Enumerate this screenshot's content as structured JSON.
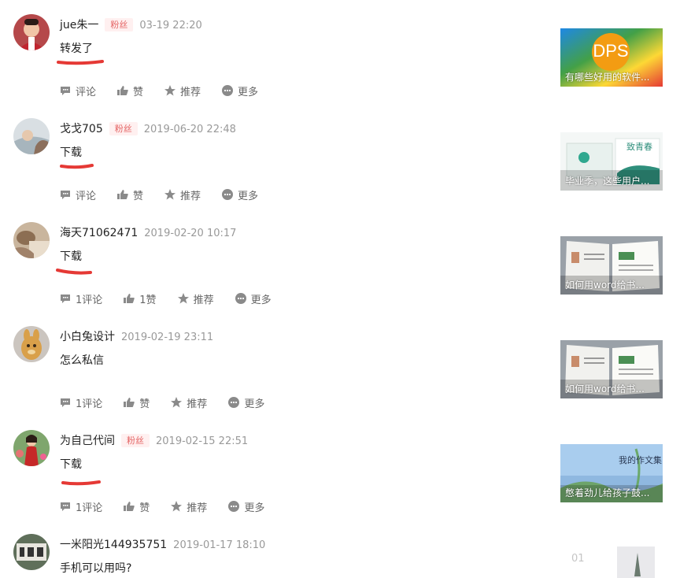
{
  "comments": [
    {
      "name": "jue朱一",
      "fan_badge": "粉丝",
      "time": "03-19 22:20",
      "text": "转发了",
      "actions": {
        "comment": "评论",
        "like": "赞",
        "recommend": "推荐",
        "more": "更多"
      },
      "thumb_caption": "有哪些好用的软件...",
      "thumb_logo": "DPS"
    },
    {
      "name": "戈戈705",
      "fan_badge": "粉丝",
      "time": "2019-06-20 22:48",
      "text": "下载",
      "actions": {
        "comment": "评论",
        "like": "赞",
        "recommend": "推荐",
        "more": "更多"
      },
      "thumb_caption": "毕业季，这些用户...",
      "thumb_title": "致青春"
    },
    {
      "name": "海天71062471",
      "time": "2019-02-20 10:17",
      "text": "下载",
      "actions": {
        "comment": "1评论",
        "like": "1赞",
        "recommend": "推荐",
        "more": "更多"
      },
      "thumb_caption": "如何用word给书..."
    },
    {
      "name": "小白兔设计",
      "time": "2019-02-19 23:11",
      "text": "怎么私信",
      "actions": {
        "comment": "1评论",
        "like": "赞",
        "recommend": "推荐",
        "more": "更多"
      },
      "thumb_caption": "如何用word给书..."
    },
    {
      "name": "为自己代间",
      "fan_badge": "粉丝",
      "time": "2019-02-15 22:51",
      "text": "下载",
      "actions": {
        "comment": "1评论",
        "like": "赞",
        "recommend": "推荐",
        "more": "更多"
      },
      "thumb_caption": "憋着劲儿给孩子鼓...",
      "thumb_title": "我的作文集"
    },
    {
      "name": "一米阳光144935751",
      "time": "2019-01-17 18:10",
      "text": "手机可以用吗?",
      "thumb_mark": "01"
    }
  ],
  "colors": {
    "underline": "#e53935",
    "muted": "#999999",
    "badge_text": "#e46464",
    "badge_bg": "#fff0f0"
  }
}
